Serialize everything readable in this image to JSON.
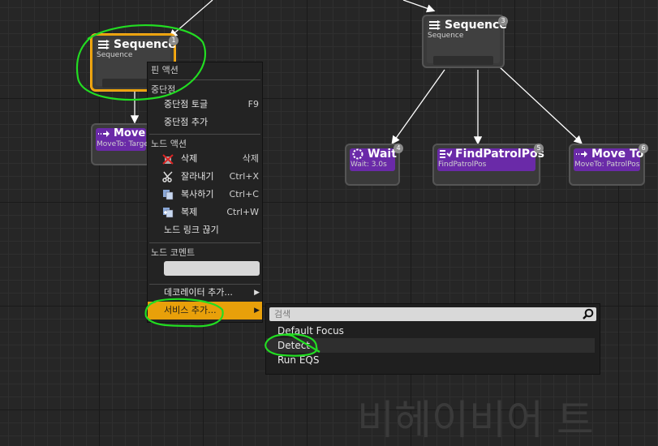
{
  "nodes": {
    "seq_left": {
      "title": "Sequence",
      "sub": "Sequence",
      "index": "1"
    },
    "move_left": {
      "title": "Move T",
      "sub": "MoveTo: Target"
    },
    "seq_right": {
      "title": "Sequence",
      "sub": "Sequence",
      "index": "3"
    },
    "wait": {
      "title": "Wait",
      "sub": "Wait: 3.0s",
      "index": "4"
    },
    "find": {
      "title": "FindPatrolPos",
      "sub": "FindPatrolPos",
      "index": "5"
    },
    "move_right": {
      "title": "Move To",
      "sub": "MoveTo: PatrolPos",
      "index": "6"
    }
  },
  "context_menu": {
    "pin_actions_header": "핀 액션",
    "breakpoint_header": "중단점",
    "toggle_breakpoint": "중단점 토글",
    "toggle_breakpoint_shortcut": "F9",
    "add_breakpoint": "중단점 추가",
    "node_actions_header": "노드 액션",
    "delete": "삭제",
    "delete_shortcut": "삭제",
    "cut": "잘라내기",
    "cut_shortcut": "Ctrl+X",
    "copy": "복사하기",
    "copy_shortcut": "Ctrl+C",
    "duplicate": "복제",
    "duplicate_shortcut": "Ctrl+W",
    "break_links": "노드 링크 끊기",
    "node_comment_header": "노드 코멘트",
    "add_decorator": "데코레이터 추가...",
    "add_service": "서비스 추가..."
  },
  "service_submenu": {
    "search_placeholder": "검색",
    "options": [
      "Default Focus",
      "Detect",
      "Run EQS"
    ],
    "selected": "Detect"
  },
  "watermark": "비헤이비어 트",
  "colors": {
    "selection": "#e8a00a",
    "task": "#6a2aa8",
    "annotation": "#22dd22"
  }
}
